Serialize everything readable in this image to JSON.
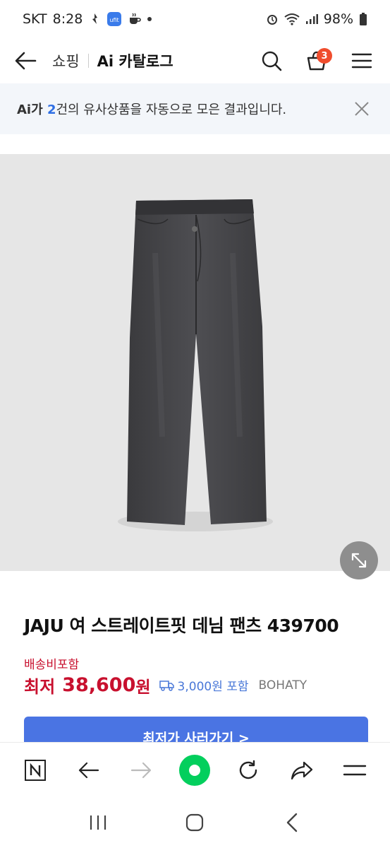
{
  "status_bar": {
    "carrier": "SKT",
    "time": "8:28",
    "battery": "98%",
    "app_badge": "ufit"
  },
  "header": {
    "section": "쇼핑",
    "title": "Ai 카탈로그",
    "cart_count": "3"
  },
  "notice": {
    "prefix": "Ai가 ",
    "count": "2",
    "suffix": "건의 유사상품을 자동으로 모은 결과입니다."
  },
  "product": {
    "title": "JAJU 여 스트레이트핏 데님 팬츠 439700",
    "shipping_label": "배송비포함",
    "price_label": "최저",
    "price": "38,600",
    "price_unit": "원",
    "shipping_fee": "3,000원 포함",
    "seller": "BOHATY",
    "cta_label": "최저가 사러가기 >"
  },
  "colors": {
    "price": "#c8102e",
    "accent": "#4a74e3",
    "home": "#03cf5d",
    "badge": "#f04d2d"
  },
  "icons": [
    "back-arrow-icon",
    "search-icon",
    "cart-icon",
    "menu-icon",
    "close-icon",
    "expand-icon",
    "truck-icon",
    "naver-n-icon",
    "forward-icon",
    "home-icon",
    "refresh-icon",
    "share-icon"
  ]
}
